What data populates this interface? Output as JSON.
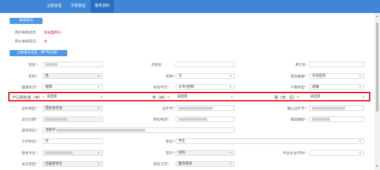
{
  "topbar": {
    "tabs": [
      {
        "label": "注册信息",
        "active": false
      },
      {
        "label": "手机绑定",
        "active": false
      },
      {
        "label": "报考资料",
        "active": true
      }
    ]
  },
  "audit_section": {
    "button_label": "审核情况",
    "status_label": "照片审核状态:",
    "status_value": "未采集照片",
    "reason_label": "照片审核情况:",
    "reason_value": "无"
  },
  "basic_section": {
    "button_label": "注册基本信息（带*号必填）"
  },
  "fields": {
    "name": {
      "label": "姓名",
      "required": true,
      "value": ""
    },
    "used_name": {
      "label": "曾用名",
      "required": false,
      "value": ""
    },
    "english_name": {
      "label": "英文名",
      "required": false,
      "value": ""
    },
    "gender": {
      "label": "性别",
      "required": true,
      "value": "男"
    },
    "ethnicity": {
      "label": "民族",
      "required": true,
      "value": "汉"
    },
    "political": {
      "label": "政治面貌",
      "required": true,
      "value": "共青团员"
    },
    "health": {
      "label": "健康状况",
      "required": true,
      "value": "健康"
    },
    "exam_language": {
      "label": "考前学历",
      "required": true,
      "value": "大专(含肄)"
    },
    "hukou_type": {
      "label": "户籍类型",
      "required": true,
      "value": "城镇"
    },
    "province": {
      "label": "户口所在省（市）",
      "required": true,
      "value": "请选择"
    },
    "city": {
      "label": "市（州）",
      "required": true,
      "value": "请选择"
    },
    "county": {
      "label": "县（市、区）",
      "required": true,
      "value": "请选择"
    },
    "id_type": {
      "label": "证件类型",
      "required": true,
      "value": "居民身份证"
    },
    "id_number": {
      "label": "证件号",
      "required": true,
      "value": ""
    },
    "confirm_id": {
      "label": "确认证件号",
      "required": true,
      "value": ""
    },
    "birth_date": {
      "label": "出生日期",
      "required": true,
      "value": ""
    },
    "mobile": {
      "label": "移动电话",
      "required": true,
      "value": ""
    },
    "postcode": {
      "label": "邮政编码",
      "required": true,
      "value": ""
    },
    "address": {
      "label": "通讯地址",
      "required": true,
      "value": "成都市"
    },
    "work_unit": {
      "label": "工作单位",
      "required": true,
      "value": "无"
    },
    "occupation": {
      "label": "职业",
      "required": true,
      "value": "学生"
    },
    "major": {
      "label": "报考专业",
      "required": true,
      "value": ""
    },
    "level": {
      "label": "层次",
      "required": true,
      "value": "本科"
    },
    "cert_major": {
      "label": "毕业专业/学科",
      "required": true,
      "value": ""
    },
    "exam_type": {
      "label": "考生类型",
      "required": true,
      "value": "应届普考生"
    },
    "exam_category": {
      "label": "报名方式",
      "required": true,
      "value": "集体报考"
    }
  }
}
